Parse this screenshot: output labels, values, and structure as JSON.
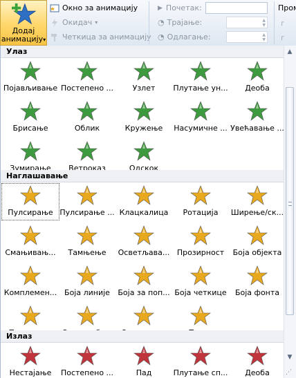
{
  "ribbon": {
    "add_animation": {
      "line1": "Додај",
      "line2": "анимацију",
      "arrow": "▾"
    },
    "animation_pane": "Окно за анимацију",
    "trigger": "Окидач",
    "trigger_arrow": "▾",
    "animation_painter": "Четкица за анимацију",
    "start_label": "Почетак:",
    "start_value": "",
    "duration_label": "Трајање:",
    "delay_label": "Одлагање:",
    "reorder_label": "Пром"
  },
  "sections": [
    {
      "title": "Улаз",
      "items": [
        "Појављивање",
        "Постепено ...",
        "Узлет",
        "Плутање ун...",
        "Деоба",
        "Брисање",
        "Облик",
        "Кружење",
        "Насумичне ...",
        "Увећавање ...",
        "Зумирање",
        "Ветроказ",
        "Одскок"
      ]
    },
    {
      "title": "Наглашавање",
      "items": [
        "Пулсирање",
        "Пулсирање ...",
        "Клацкалица",
        "Ротација",
        "Ширење/ск...",
        "Смањивањ...",
        "Тамњење",
        "Осветљава...",
        "Прозирност",
        "Боја објекта",
        "Комплемен...",
        "Боја линије",
        "Боја за поп...",
        "Боја четкице",
        "Боја фонта",
        "Подвучено",
        "Снажан бл...",
        "Откривање",
        "Талас"
      ]
    },
    {
      "title": "Излаз",
      "items": [
        "Нестајање",
        "Постепено ...",
        "Пад",
        "Плутање сп...",
        "Деоба"
      ]
    }
  ],
  "colors": {
    "entrance": "#3e9a3e",
    "emphasis": "#e8a91f",
    "exit": "#c0353c",
    "accent": "#ffd76b"
  }
}
